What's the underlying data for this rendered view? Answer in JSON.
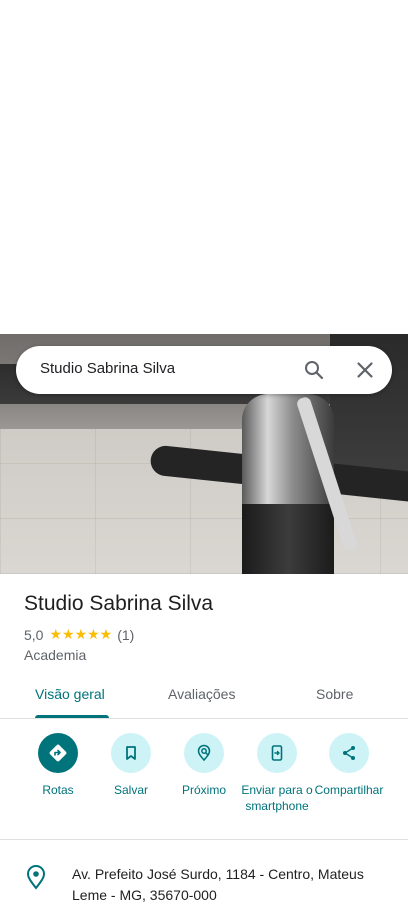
{
  "search": {
    "query": "Studio Sabrina Silva"
  },
  "place": {
    "name": "Studio Sabrina Silva",
    "rating": "5,0",
    "stars": "★★★★★",
    "review_count": "(1)",
    "category": "Academia"
  },
  "tabs": [
    {
      "label": "Visão geral",
      "active": true
    },
    {
      "label": "Avaliações",
      "active": false
    },
    {
      "label": "Sobre",
      "active": false
    }
  ],
  "actions": [
    {
      "label": "Rotas",
      "icon": "directions-icon"
    },
    {
      "label": "Salvar",
      "icon": "bookmark-icon"
    },
    {
      "label": "Próximo",
      "icon": "nearby-icon"
    },
    {
      "label": "Enviar para o smartphone",
      "icon": "send-to-phone-icon"
    },
    {
      "label": "Compartilhar",
      "icon": "share-icon"
    }
  ],
  "address": {
    "text": "Av. Prefeito José Surdo, 1184 - Centro, Mateus Leme - MG, 35670-000",
    "icon": "location-pin-icon"
  },
  "colors": {
    "accent": "#00737b",
    "action_bg": "#cdf3f7",
    "star": "#fbbc04"
  }
}
